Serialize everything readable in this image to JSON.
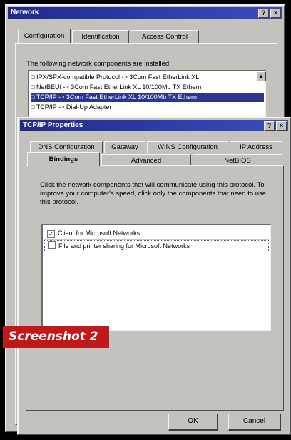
{
  "network": {
    "title": "Network",
    "tabs": [
      "Configuration",
      "Identification",
      "Access Control"
    ],
    "installed_label": "The following network components are installed:",
    "components": [
      "IPX/SPX-compatible Protocol -> 3Com Fast EtherLink XL",
      "NetBEUI -> 3Com Fast EtherLink XL 10/100Mb TX Ethern",
      "TCP/IP -> 3Com Fast EtherLink XL 10/100Mb TX Ethern",
      "TCP/IP -> Dial-Up Adapter"
    ],
    "selected_index": 2
  },
  "tcpip": {
    "title": "TCP/IP Properties",
    "tabs_back": [
      "DNS Configuration",
      "Gateway",
      "WINS Configuration",
      "IP Address"
    ],
    "tabs_front": [
      "Bindings",
      "Advanced",
      "NetBIOS"
    ],
    "active_tab": "Bindings",
    "description": "Click the network components that will communicate using this protocol. To improve your computer's speed, click only the components that need to use this protocol.",
    "bindings": [
      {
        "label": "Client for Microsoft Networks",
        "checked": true
      },
      {
        "label": "File and printer sharing for Microsoft Networks",
        "checked": false
      }
    ],
    "ok_label": "OK",
    "cancel_label": "Cancel"
  },
  "title_buttons": {
    "help": "?",
    "close": "×"
  },
  "caption": "Screenshot 2",
  "colors": {
    "title_bar": "#2a3790",
    "caption_bg": "#c0191c",
    "face": "#c4c2bc"
  }
}
